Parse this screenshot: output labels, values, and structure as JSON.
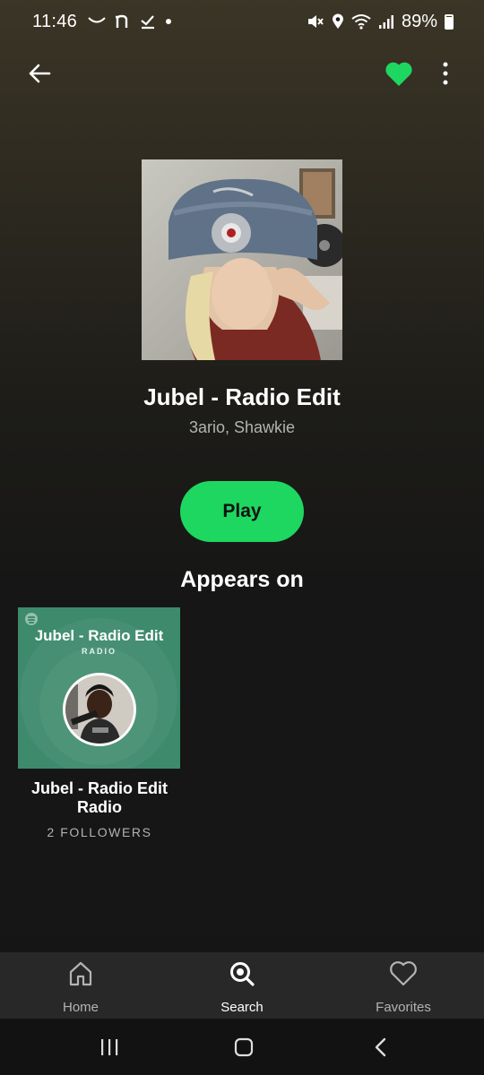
{
  "status_bar": {
    "time": "11:46",
    "battery": "89%"
  },
  "track": {
    "title": "Jubel - Radio Edit",
    "artists": "3ario, Shawkie",
    "liked": true
  },
  "actions": {
    "play_label": "Play"
  },
  "appears_on": {
    "heading": "Appears on",
    "items": [
      {
        "cover_title": "Jubel - Radio Edit",
        "cover_subtitle": "RADIO",
        "title": "Jubel - Radio Edit Radio",
        "followers": "2 FOLLOWERS"
      }
    ]
  },
  "bottom_nav": {
    "items": [
      {
        "label": "Home",
        "icon": "home-icon",
        "active": false
      },
      {
        "label": "Search",
        "icon": "search-icon",
        "active": true
      },
      {
        "label": "Favorites",
        "icon": "heart-outline-icon",
        "active": false
      }
    ]
  },
  "colors": {
    "accent": "#1ed760",
    "background": "#121212",
    "nav_background": "#282828",
    "secondary_text": "#b3b3b3"
  }
}
